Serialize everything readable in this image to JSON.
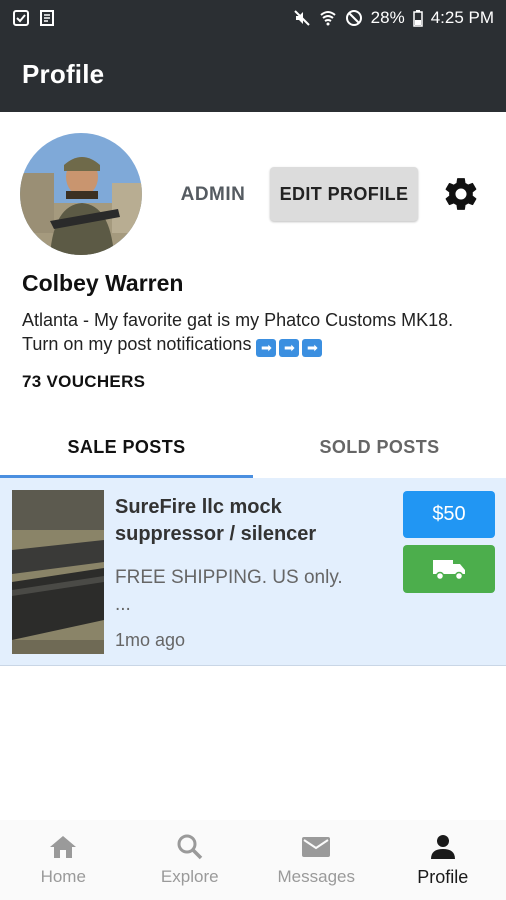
{
  "status_bar": {
    "battery": "28%",
    "time": "4:25 PM",
    "left_icons": [
      "checklist-icon",
      "document-icon"
    ],
    "right_icons": [
      "mute-icon",
      "wifi-icon",
      "no-sign-icon",
      "battery-icon"
    ]
  },
  "app_bar": {
    "title": "Profile"
  },
  "profile": {
    "admin_label": "ADMIN",
    "edit_label": "EDIT PROFILE",
    "name": "Colbey Warren",
    "bio": "Atlanta - My favorite gat is my Phatco Customs MK18. Turn on my post notifications",
    "bio_arrows": [
      "➡",
      "➡",
      "➡"
    ],
    "vouchers": "73 VOUCHERS"
  },
  "tabs": [
    {
      "label": "SALE POSTS",
      "active": true
    },
    {
      "label": "SOLD POSTS",
      "active": false
    }
  ],
  "posts": [
    {
      "title": "SureFire llc mock suppressor / silencer",
      "description": "FREE SHIPPING. US only.",
      "ellipsis": "...",
      "time": "1mo ago",
      "price": "$50",
      "shipping_icon": "truck-icon"
    }
  ],
  "bottom_nav": [
    {
      "label": "Home",
      "icon": "home-icon",
      "active": false
    },
    {
      "label": "Explore",
      "icon": "search-icon",
      "active": false
    },
    {
      "label": "Messages",
      "icon": "mail-icon",
      "active": false
    },
    {
      "label": "Profile",
      "icon": "person-icon",
      "active": true
    }
  ],
  "colors": {
    "app_bar": "#2b2f33",
    "tab_indicator": "#4a8fe0",
    "card_background": "#e3effd",
    "price_button": "#2196f3",
    "shipping_button": "#4cae4c"
  }
}
